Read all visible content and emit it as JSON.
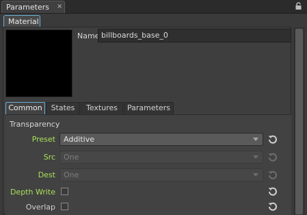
{
  "dock": {
    "tab_title": "Parameters",
    "close_glyph": "×",
    "lock_icon": "lock-icon"
  },
  "material_tab": {
    "label": "Material"
  },
  "name_field": {
    "label": "Name",
    "value": "billboards_base_0"
  },
  "inner_tabs": [
    "Common",
    "States",
    "Textures",
    "Parameters"
  ],
  "active_tab": "Common",
  "section": {
    "title": "Transparency"
  },
  "rows": {
    "preset": {
      "label": "Preset",
      "value": "Additive"
    },
    "src": {
      "label": "Src",
      "value": "One"
    },
    "dest": {
      "label": "Dest",
      "value": "One"
    },
    "depth_write": {
      "label": "Depth Write"
    },
    "overlap": {
      "label": "Overlap"
    }
  },
  "colors": {
    "accent": "#6ab0d6",
    "modified_label": "#a8e05a"
  }
}
